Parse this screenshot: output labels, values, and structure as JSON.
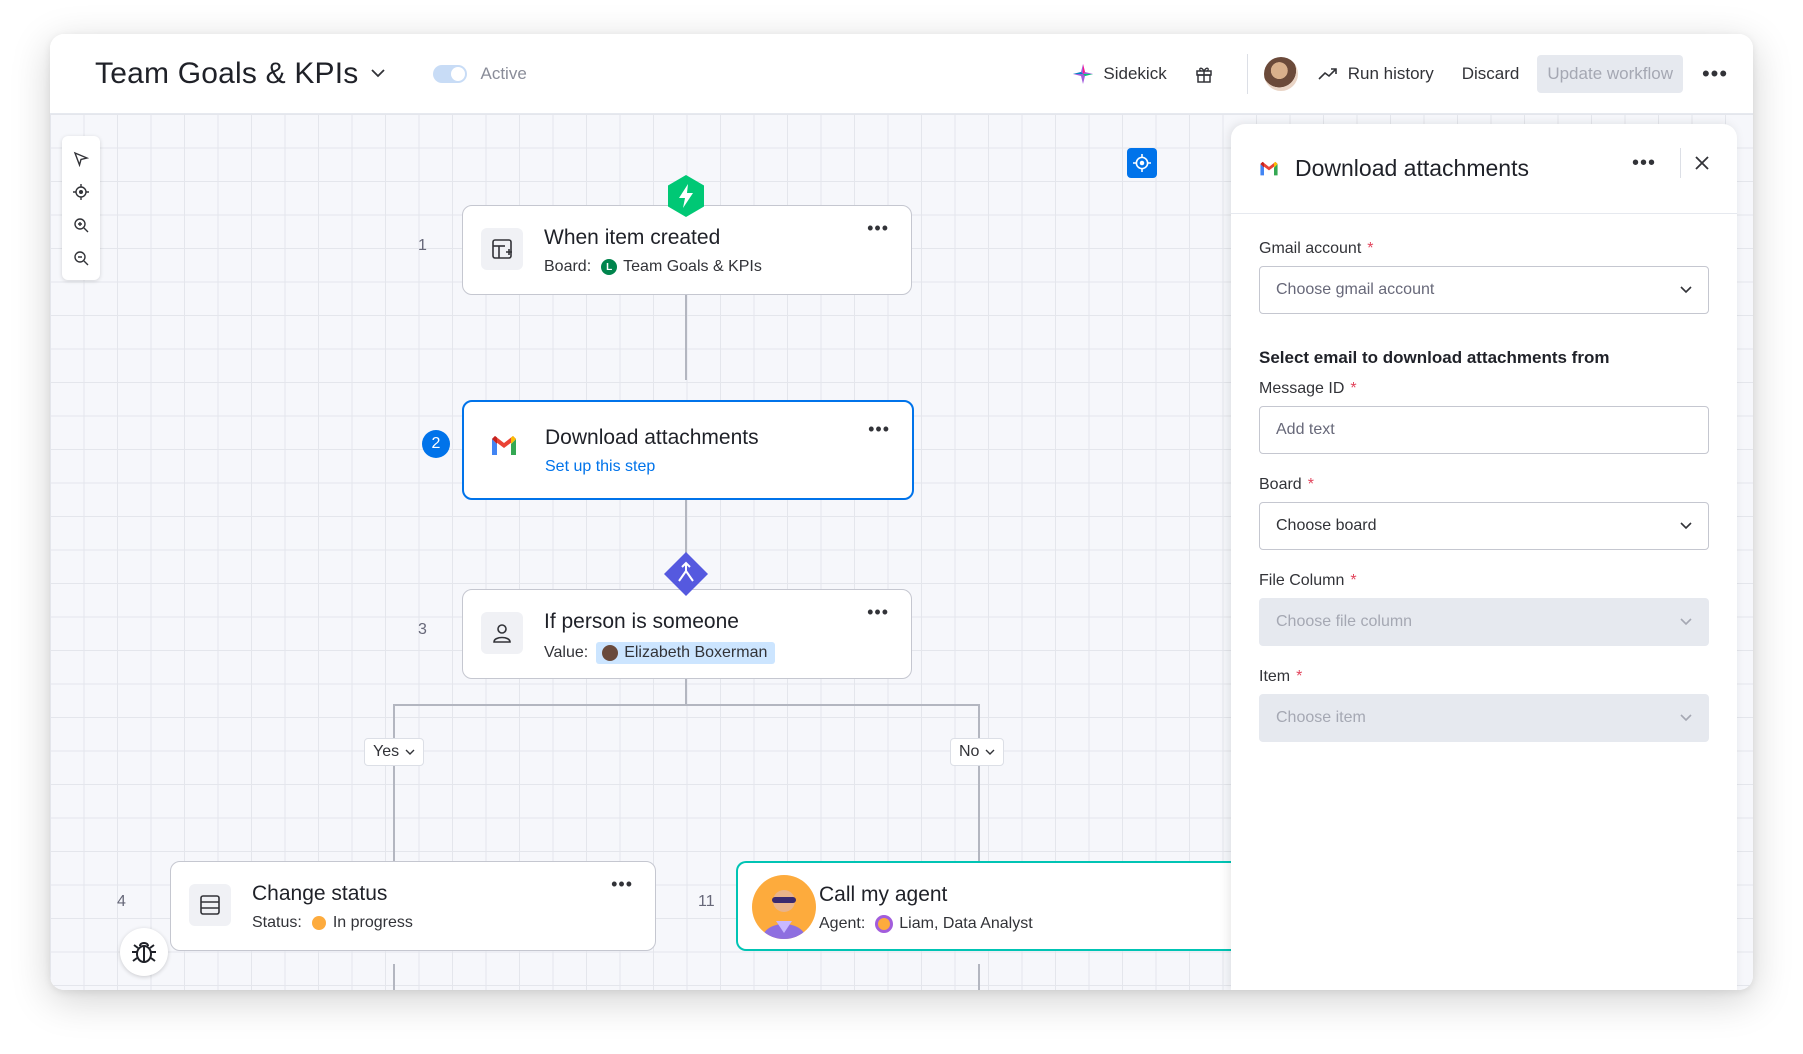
{
  "header": {
    "title": "Team Goals & KPIs",
    "active_label": "Active",
    "sidekick_label": "Sidekick",
    "run_history_label": "Run history",
    "discard_label": "Discard",
    "update_label": "Update workflow"
  },
  "steps": [
    {
      "number": "1",
      "title": "When item created",
      "sub_label": "Board:",
      "sub_value": "Team Goals & KPIs",
      "board_letter": "L"
    },
    {
      "number": "2",
      "title": "Download attachments",
      "sub_value": "Set up this step"
    },
    {
      "number": "3",
      "title": "If person is someone",
      "sub_label": "Value:",
      "sub_value": "Elizabeth Boxerman"
    },
    {
      "number": "4",
      "title": "Change status",
      "sub_label": "Status:",
      "sub_value": "In progress"
    },
    {
      "number": "11",
      "title": "Call my agent",
      "sub_label": "Agent:",
      "sub_value": "Liam, Data Analyst"
    }
  ],
  "branches": {
    "yes_label": "Yes",
    "no_label": "No"
  },
  "panel": {
    "title": "Download attachments",
    "fields": [
      {
        "label": "Gmail account",
        "placeholder": "Choose gmail account"
      },
      {
        "label": "Message ID",
        "placeholder": "Add text"
      },
      {
        "label": "Board",
        "placeholder": "Choose board"
      },
      {
        "label": "File Column",
        "placeholder": "Choose file column"
      },
      {
        "label": "Item",
        "placeholder": "Choose item"
      }
    ],
    "section_title": "Select email to download attachments from",
    "required_mark": "*"
  },
  "colors": {
    "accent": "#0073ea",
    "trigger": "#00c875",
    "condition": "#5559df",
    "status_in_progress": "#fdab3d",
    "agent_border": "#00c4b4"
  },
  "icons": [
    "chevron-down-icon",
    "sidekick-icon",
    "gift-icon",
    "run-history-icon",
    "more-icon",
    "pointer-icon",
    "target-icon",
    "zoom-in-icon",
    "zoom-out-icon",
    "lightning-icon",
    "board-icon",
    "gmail-icon",
    "branch-icon",
    "person-icon",
    "table-icon",
    "bug-icon",
    "close-icon"
  ]
}
